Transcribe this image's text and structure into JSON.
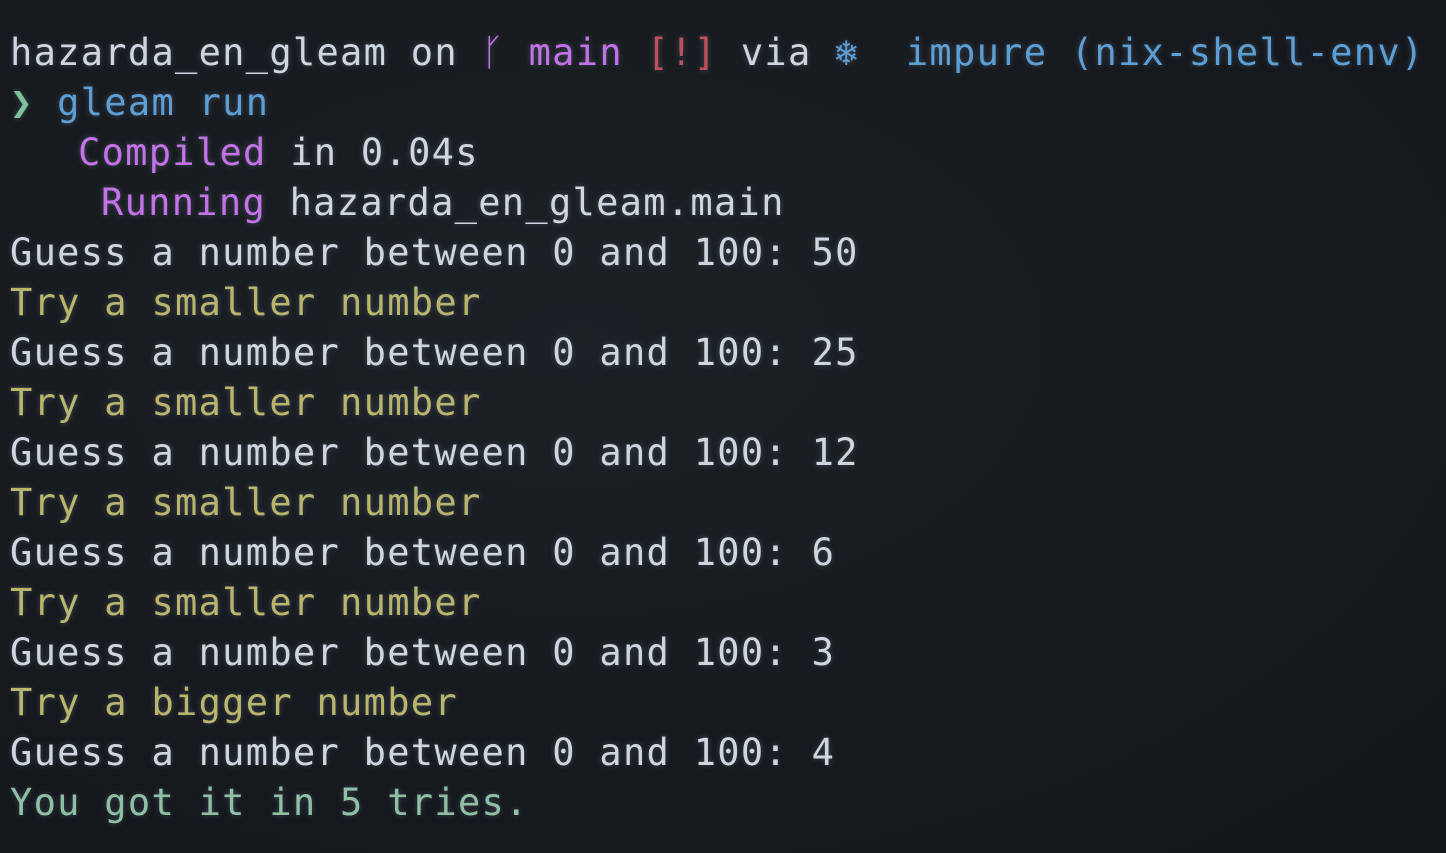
{
  "prompt": {
    "dir": "hazarda_en_gleam",
    "on": "on",
    "branch_icon": "ᚴ",
    "branch": "main",
    "status": "[!]",
    "via": "via",
    "nix_icon": "❄",
    "env": "impure (nix-shell-env)"
  },
  "command": {
    "chevron": "❯",
    "text": "gleam run"
  },
  "build": {
    "compiled_label": "Compiled",
    "compiled_rest": "in 0.04s",
    "running_label": "Running",
    "running_rest": "hazarda_en_gleam.main"
  },
  "output": [
    {
      "text": "Guess a number between 0 and 100: 50",
      "kind": "guess"
    },
    {
      "text": "Try a smaller number",
      "kind": "hint"
    },
    {
      "text": "Guess a number between 0 and 100: 25",
      "kind": "guess"
    },
    {
      "text": "Try a smaller number",
      "kind": "hint"
    },
    {
      "text": "Guess a number between 0 and 100: 12",
      "kind": "guess"
    },
    {
      "text": "Try a smaller number",
      "kind": "hint"
    },
    {
      "text": "Guess a number between 0 and 100: 6",
      "kind": "guess"
    },
    {
      "text": "Try a smaller number",
      "kind": "hint"
    },
    {
      "text": "Guess a number between 0 and 100: 3",
      "kind": "guess"
    },
    {
      "text": "Try a bigger number",
      "kind": "hint"
    },
    {
      "text": "Guess a number between 0 and 100: 4",
      "kind": "guess"
    },
    {
      "text": "You got it in 5 tries.",
      "kind": "success"
    }
  ],
  "colors": {
    "background": "#15191d",
    "text": "#cfd6df",
    "purple": "#c472e8",
    "red": "#c14f5a",
    "blue": "#5b9fd6",
    "green": "#7fbf9a",
    "yellow": "#b9b56d"
  }
}
